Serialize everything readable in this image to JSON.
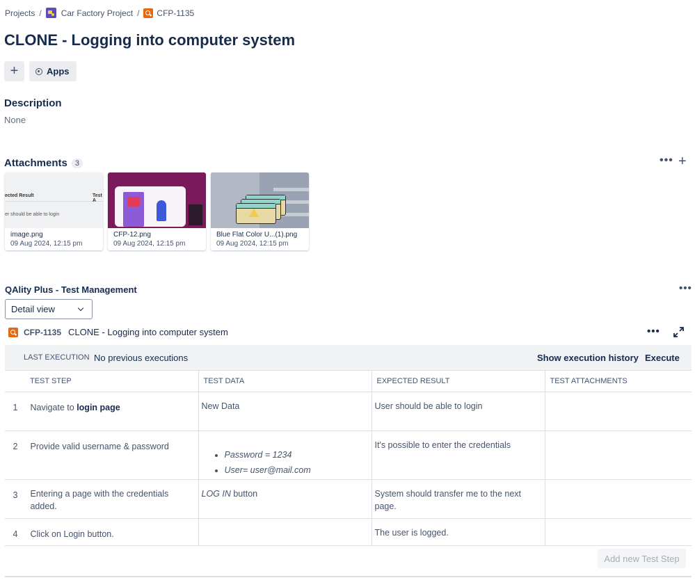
{
  "breadcrumb": {
    "projects": "Projects",
    "project": "Car Factory Project",
    "issue": "CFP-1135",
    "sep": "/"
  },
  "title": "CLONE - Logging into computer system",
  "toolbar": {
    "add_icon": "plus-icon",
    "apps_label": "Apps",
    "apps_icon": "apps-icon"
  },
  "description": {
    "label": "Description",
    "value": "None"
  },
  "attachments": {
    "label": "Attachments",
    "count": "3",
    "items": [
      {
        "name": "image.png",
        "date": "09 Aug 2024, 12:15 pm",
        "thumb_text_1": "ected Result",
        "thumb_text_2": "Test A",
        "thumb_text_3": "er should be able to login"
      },
      {
        "name": "CFP-12.png",
        "date": "09 Aug 2024, 12:15 pm"
      },
      {
        "name": "Blue Flat Color U...(1).png",
        "date": "09 Aug 2024, 12:15 pm"
      }
    ]
  },
  "qality": {
    "title": "QAlity Plus - Test Management",
    "view_select": "Detail view",
    "issue_key": "CFP-1135",
    "issue_summary": "CLONE - Logging into computer system",
    "exec": {
      "label": "LAST EXECUTION",
      "value": "No previous executions",
      "history": "Show execution history",
      "execute": "Execute"
    },
    "columns": [
      "TEST STEP",
      "TEST DATA",
      "EXPECTED RESULT",
      "TEST ATTACHMENTS"
    ],
    "steps": [
      {
        "num": "1",
        "step_plain": "Navigate to ",
        "step_bold": "login page",
        "data": "New Data",
        "expected": "User should be able to login"
      },
      {
        "num": "2",
        "step": "Provide valid username & password",
        "data_items": [
          "Password = 1234",
          "User= user@mail.com"
        ],
        "expected": "It's possible to enter the credentials"
      },
      {
        "num": "3",
        "step": "Entering a page with the credentials added.",
        "data_italic": "LOG IN",
        "data_rest": " button",
        "expected": "System should transfer me to the next page."
      },
      {
        "num": "4",
        "step": "Click on Login button.",
        "data": "",
        "expected": "The user is logged."
      }
    ],
    "add_step": "Add new Test Step"
  },
  "colors": {
    "text": "#172b4d",
    "muted": "#44546f",
    "issue_icon": "#e56910",
    "project_icon": "#5e4db2"
  }
}
